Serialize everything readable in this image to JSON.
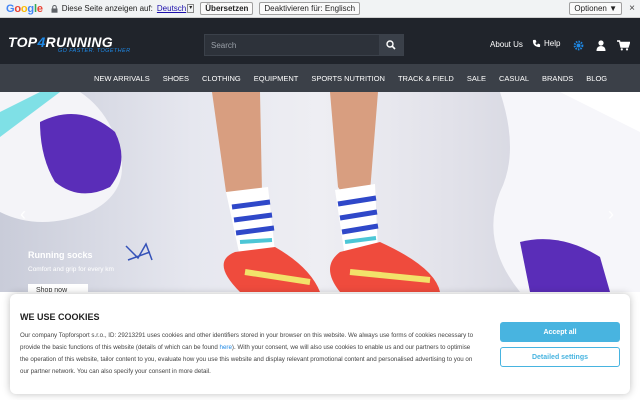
{
  "translate_bar": {
    "brand": "Google",
    "message": "Diese Seite anzeigen auf:",
    "language": "Deutsch",
    "translate_label": "Übersetzen",
    "disable_label": "Deaktivieren für: Englisch",
    "options_label": "Optionen ▼",
    "close": "×"
  },
  "header": {
    "logo_text_a": "TOP",
    "logo_text_b": "4",
    "logo_text_c": "RUNNING",
    "slogan": "GO FASTER. TOGETHER",
    "search_placeholder": "Search",
    "about_label": "About Us",
    "help_label": "Help",
    "icons": [
      "search-icon",
      "phone-icon",
      "gear-icon",
      "user-icon",
      "cart-icon"
    ]
  },
  "nav": {
    "items": [
      "NEW ARRIVALS",
      "SHOES",
      "CLOTHING",
      "EQUIPMENT",
      "SPORTS NUTRITION",
      "TRACK & FIELD",
      "SALE",
      "CASUAL",
      "BRANDS",
      "BLOG"
    ]
  },
  "hero": {
    "title": "Running socks",
    "subtitle": "Comfort and grip for every km",
    "button": "Shop now"
  },
  "cookie": {
    "title": "WE USE COOKIES",
    "text_before_link": "Our company Topforsport s.r.o., ID: 29213291 uses cookies and other identifiers stored in your browser on this website. We always use forms of cookies necessary to provide the basic functions of this website (details of which can be found ",
    "link": "here",
    "text_after_link": "). With your consent, we will also use cookies to enable us and our partners to optimise the operation of this website, tailor content to you, evaluate how you use this website and display relevant promotional content and personalised advertising to you on our partner network. You can also specify your consent in more detail.",
    "accept_label": "Accept all",
    "details_label": "Detailed settings"
  },
  "colors": {
    "header_bg": "#20242b",
    "nav_bg": "#3b4048",
    "accent": "#1e88e5",
    "cookie_button": "#48b4e0"
  }
}
